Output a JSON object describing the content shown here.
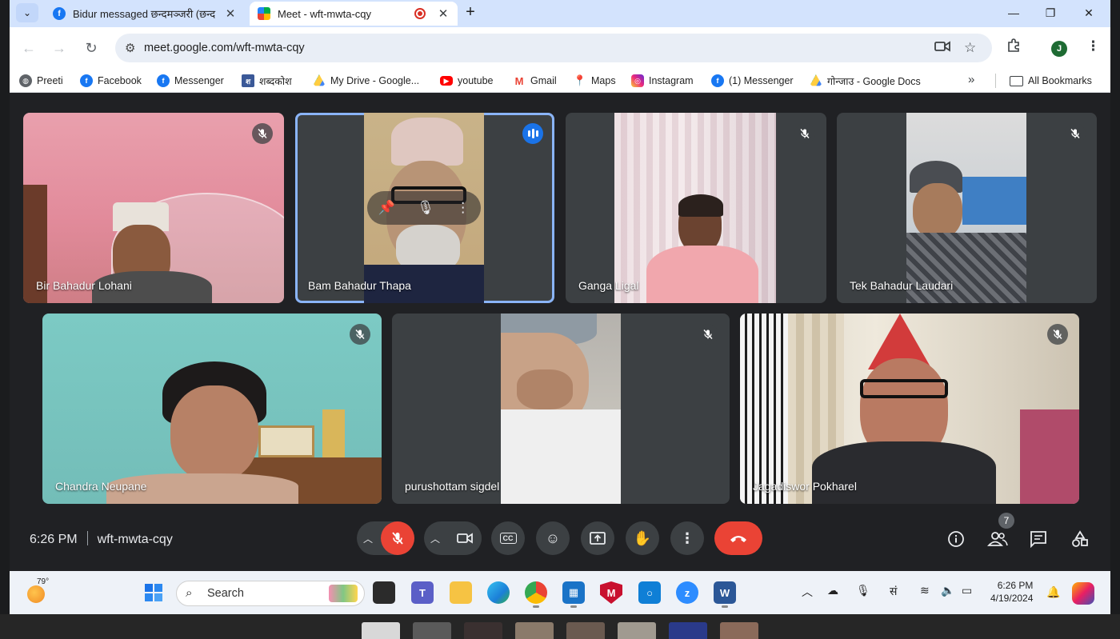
{
  "tabs": [
    {
      "title": "Bidur messaged छन्दमञ्जरी (छन्द",
      "active": false
    },
    {
      "title": "Meet - wft-mwta-cqy",
      "active": true
    }
  ],
  "window": {
    "minimize": "—",
    "maximize": "❐",
    "close": "✕"
  },
  "address": {
    "url": "meet.google.com/wft-mwta-cqy"
  },
  "profile_initial": "J",
  "bookmarks": [
    {
      "label": "Preeti",
      "color": "#5f6368"
    },
    {
      "label": "Facebook",
      "color": "#1877f2"
    },
    {
      "label": "Messenger",
      "color": "#1877f2"
    },
    {
      "label": "शब्दकोश",
      "color": "#3b5998"
    },
    {
      "label": "My Drive - Google...",
      "color": "#34a853"
    },
    {
      "label": "youtube",
      "color": "#ff0000"
    },
    {
      "label": "Gmail",
      "color": "#ea4335"
    },
    {
      "label": "Maps",
      "color": "#34a853"
    },
    {
      "label": "Instagram",
      "color": "#c13584"
    },
    {
      "label": "(1) Messenger",
      "color": "#1877f2"
    },
    {
      "label": "गोन्जाउ - Google Docs",
      "color": "#34a853"
    }
  ],
  "all_bookmarks": "All Bookmarks",
  "participants": [
    {
      "name": "Bir Bahadur Lohani",
      "muted": true,
      "speaking": false
    },
    {
      "name": "Bam Bahadur Thapa",
      "muted": false,
      "speaking": true
    },
    {
      "name": "Ganga Ligal",
      "muted": true,
      "speaking": false
    },
    {
      "name": "Tek Bahadur Laudari",
      "muted": true,
      "speaking": false
    },
    {
      "name": "Chandra Neupane",
      "muted": true,
      "speaking": false
    },
    {
      "name": "purushottam sigdel",
      "muted": true,
      "speaking": false
    },
    {
      "name": "Jagadiswor Pokharel",
      "muted": true,
      "speaking": false
    }
  ],
  "meeting": {
    "time": "6:26 PM",
    "code": "wft-mwta-cqy",
    "people_count": "7"
  },
  "taskbar": {
    "weather_temp": "79°",
    "search_label": "Search",
    "tray_lang": "सं",
    "time": "6:26 PM",
    "date": "4/19/2024"
  }
}
